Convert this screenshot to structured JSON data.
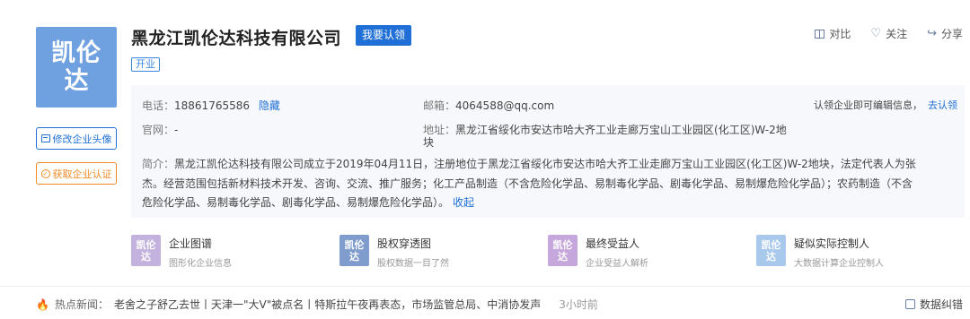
{
  "logo": {
    "line1": "凯伦",
    "line2": "达",
    "color": "#6fa0df"
  },
  "company": {
    "name": "黑龙江凯伦达科技有限公司",
    "claim_label": "我要认领",
    "status": "开业"
  },
  "side_buttons": {
    "edit_avatar": "修改企业头像",
    "get_cert": "获取企业认证"
  },
  "top_actions": [
    {
      "label": "对比",
      "icon": "compare-icon"
    },
    {
      "label": "关注",
      "icon": "heart-icon"
    },
    {
      "label": "分享",
      "icon": "share-icon"
    }
  ],
  "info": {
    "phone_label": "电话：",
    "phone": "18861765586",
    "hide_label": "隐藏",
    "email_label": "邮箱：",
    "email": "4064588@qq.com",
    "claim_hint": "认领企业即可编辑信息，",
    "claim_link": "去认领",
    "website_label": "官网：",
    "website": "-",
    "address_label": "地址：",
    "address_line1": "黑龙江省绥化市安达市哈大齐工业走廊万宝山工业园区(化工区)W-2地",
    "address_line2": "块",
    "intro_label": "简介：",
    "intro_line1": "黑龙江凯伦达科技有限公司成立于2019年04月11日，注册地位于黑龙江省绥化市安达市哈大齐工业走廊万宝山工业园区(化工区)W-2地块，法定代表人为张",
    "intro_line2": "杰。经营范围包括新材料技术开发、咨询、交流、推广服务；化工产品制造（不含危险化学品、易制毒化学品、剧毒化学品、易制爆危险化学品）；农药制造（不含",
    "intro_line3": "危险化学品、易制毒化学品、剧毒化学品、易制爆危险化学品）。",
    "collapse_label": "收起"
  },
  "features": [
    {
      "title": "企业图谱",
      "sub": "图形化企业信息",
      "icon1": "凯伦",
      "icon2": "达",
      "color": "#c3b2dd"
    },
    {
      "title": "股权穿透图",
      "sub": "股权数据一目了然",
      "icon1": "凯伦",
      "icon2": "达",
      "color": "#7f9ccd"
    },
    {
      "title": "最终受益人",
      "sub": "企业受益人解析",
      "icon1": "凯伦",
      "icon2": "达",
      "color": "#c6a7dc"
    },
    {
      "title": "疑似实际控制人",
      "sub": "大数据计算企业控制人",
      "icon1": "凯伦",
      "icon2": "达",
      "color": "#a8c9ec"
    }
  ],
  "news": {
    "label": "热点新闻：",
    "text": "老舍之子舒乙去世丨天津一\"大V\"被点名丨特斯拉午夜再表态，市场监管总局、中消协发声",
    "time": "3小时前"
  },
  "report_label": "数据纠错"
}
